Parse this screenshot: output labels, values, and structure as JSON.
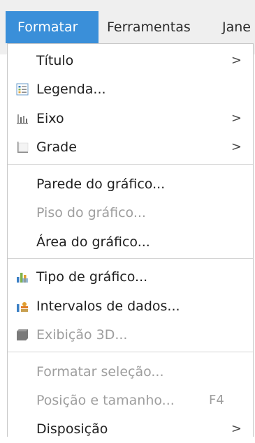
{
  "menubar": {
    "items": [
      {
        "label": "Formatar"
      },
      {
        "label": "Ferramentas"
      },
      {
        "label": "Jane"
      }
    ]
  },
  "menu": {
    "items": [
      {
        "label": "Título",
        "submenu": ">"
      },
      {
        "label": "Legenda...",
        "icon": "legend-icon"
      },
      {
        "label": "Eixo",
        "icon": "axis-icon",
        "submenu": ">"
      },
      {
        "label": "Grade",
        "icon": "grid-icon",
        "submenu": ">"
      },
      {
        "label": "Parede do gráfico..."
      },
      {
        "label": "Piso do gráfico...",
        "disabled": true
      },
      {
        "label": "Área do gráfico..."
      },
      {
        "label": "Tipo de gráfico...",
        "icon": "chart-type-icon"
      },
      {
        "label": "Intervalos de dados...",
        "icon": "data-ranges-icon"
      },
      {
        "label": "Exibição 3D...",
        "icon": "3d-view-icon",
        "disabled": true
      },
      {
        "label": "Formatar seleção...",
        "disabled": true
      },
      {
        "label": "Posição e tamanho...",
        "shortcut": "F4",
        "disabled": true
      },
      {
        "label": "Disposição",
        "submenu": ">"
      }
    ]
  },
  "colors": {
    "accent": "#3a8fd9",
    "disabled_text": "#9e9e9e",
    "menubar_bg": "#efefef"
  }
}
